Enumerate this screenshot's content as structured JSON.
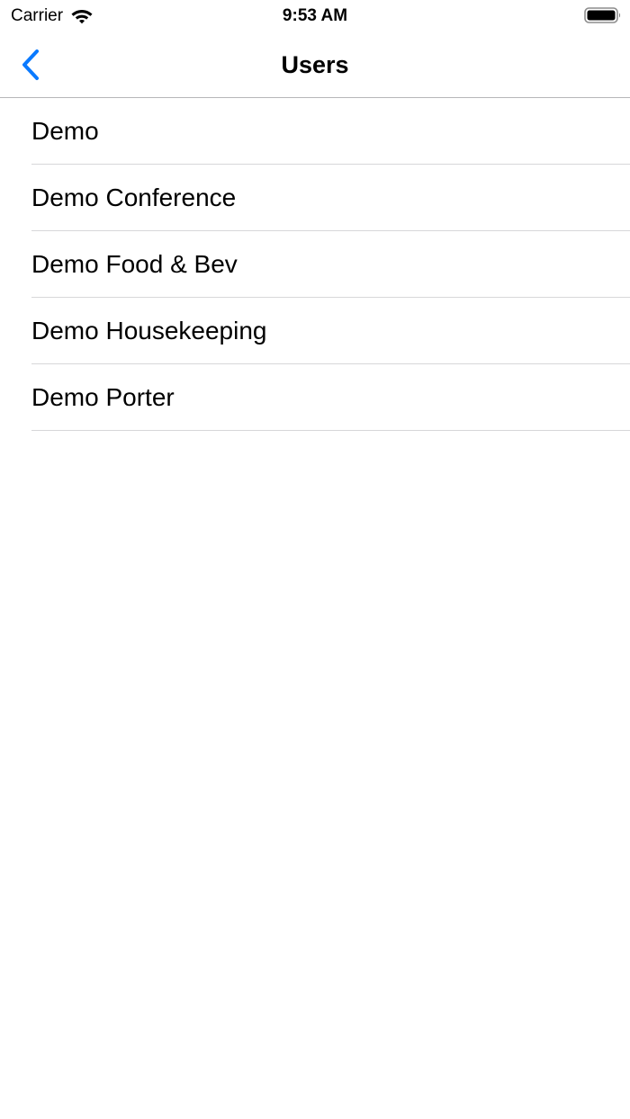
{
  "status_bar": {
    "carrier": "Carrier",
    "time": "9:53 AM",
    "wifi_icon": "wifi-icon",
    "battery_icon": "battery-icon"
  },
  "nav_bar": {
    "title": "Users",
    "back_icon": "chevron-left-icon",
    "accent_color": "#0a7aff"
  },
  "users": [
    {
      "label": "Demo"
    },
    {
      "label": "Demo Conference"
    },
    {
      "label": "Demo Food & Bev"
    },
    {
      "label": "Demo Housekeeping"
    },
    {
      "label": "Demo Porter"
    }
  ]
}
